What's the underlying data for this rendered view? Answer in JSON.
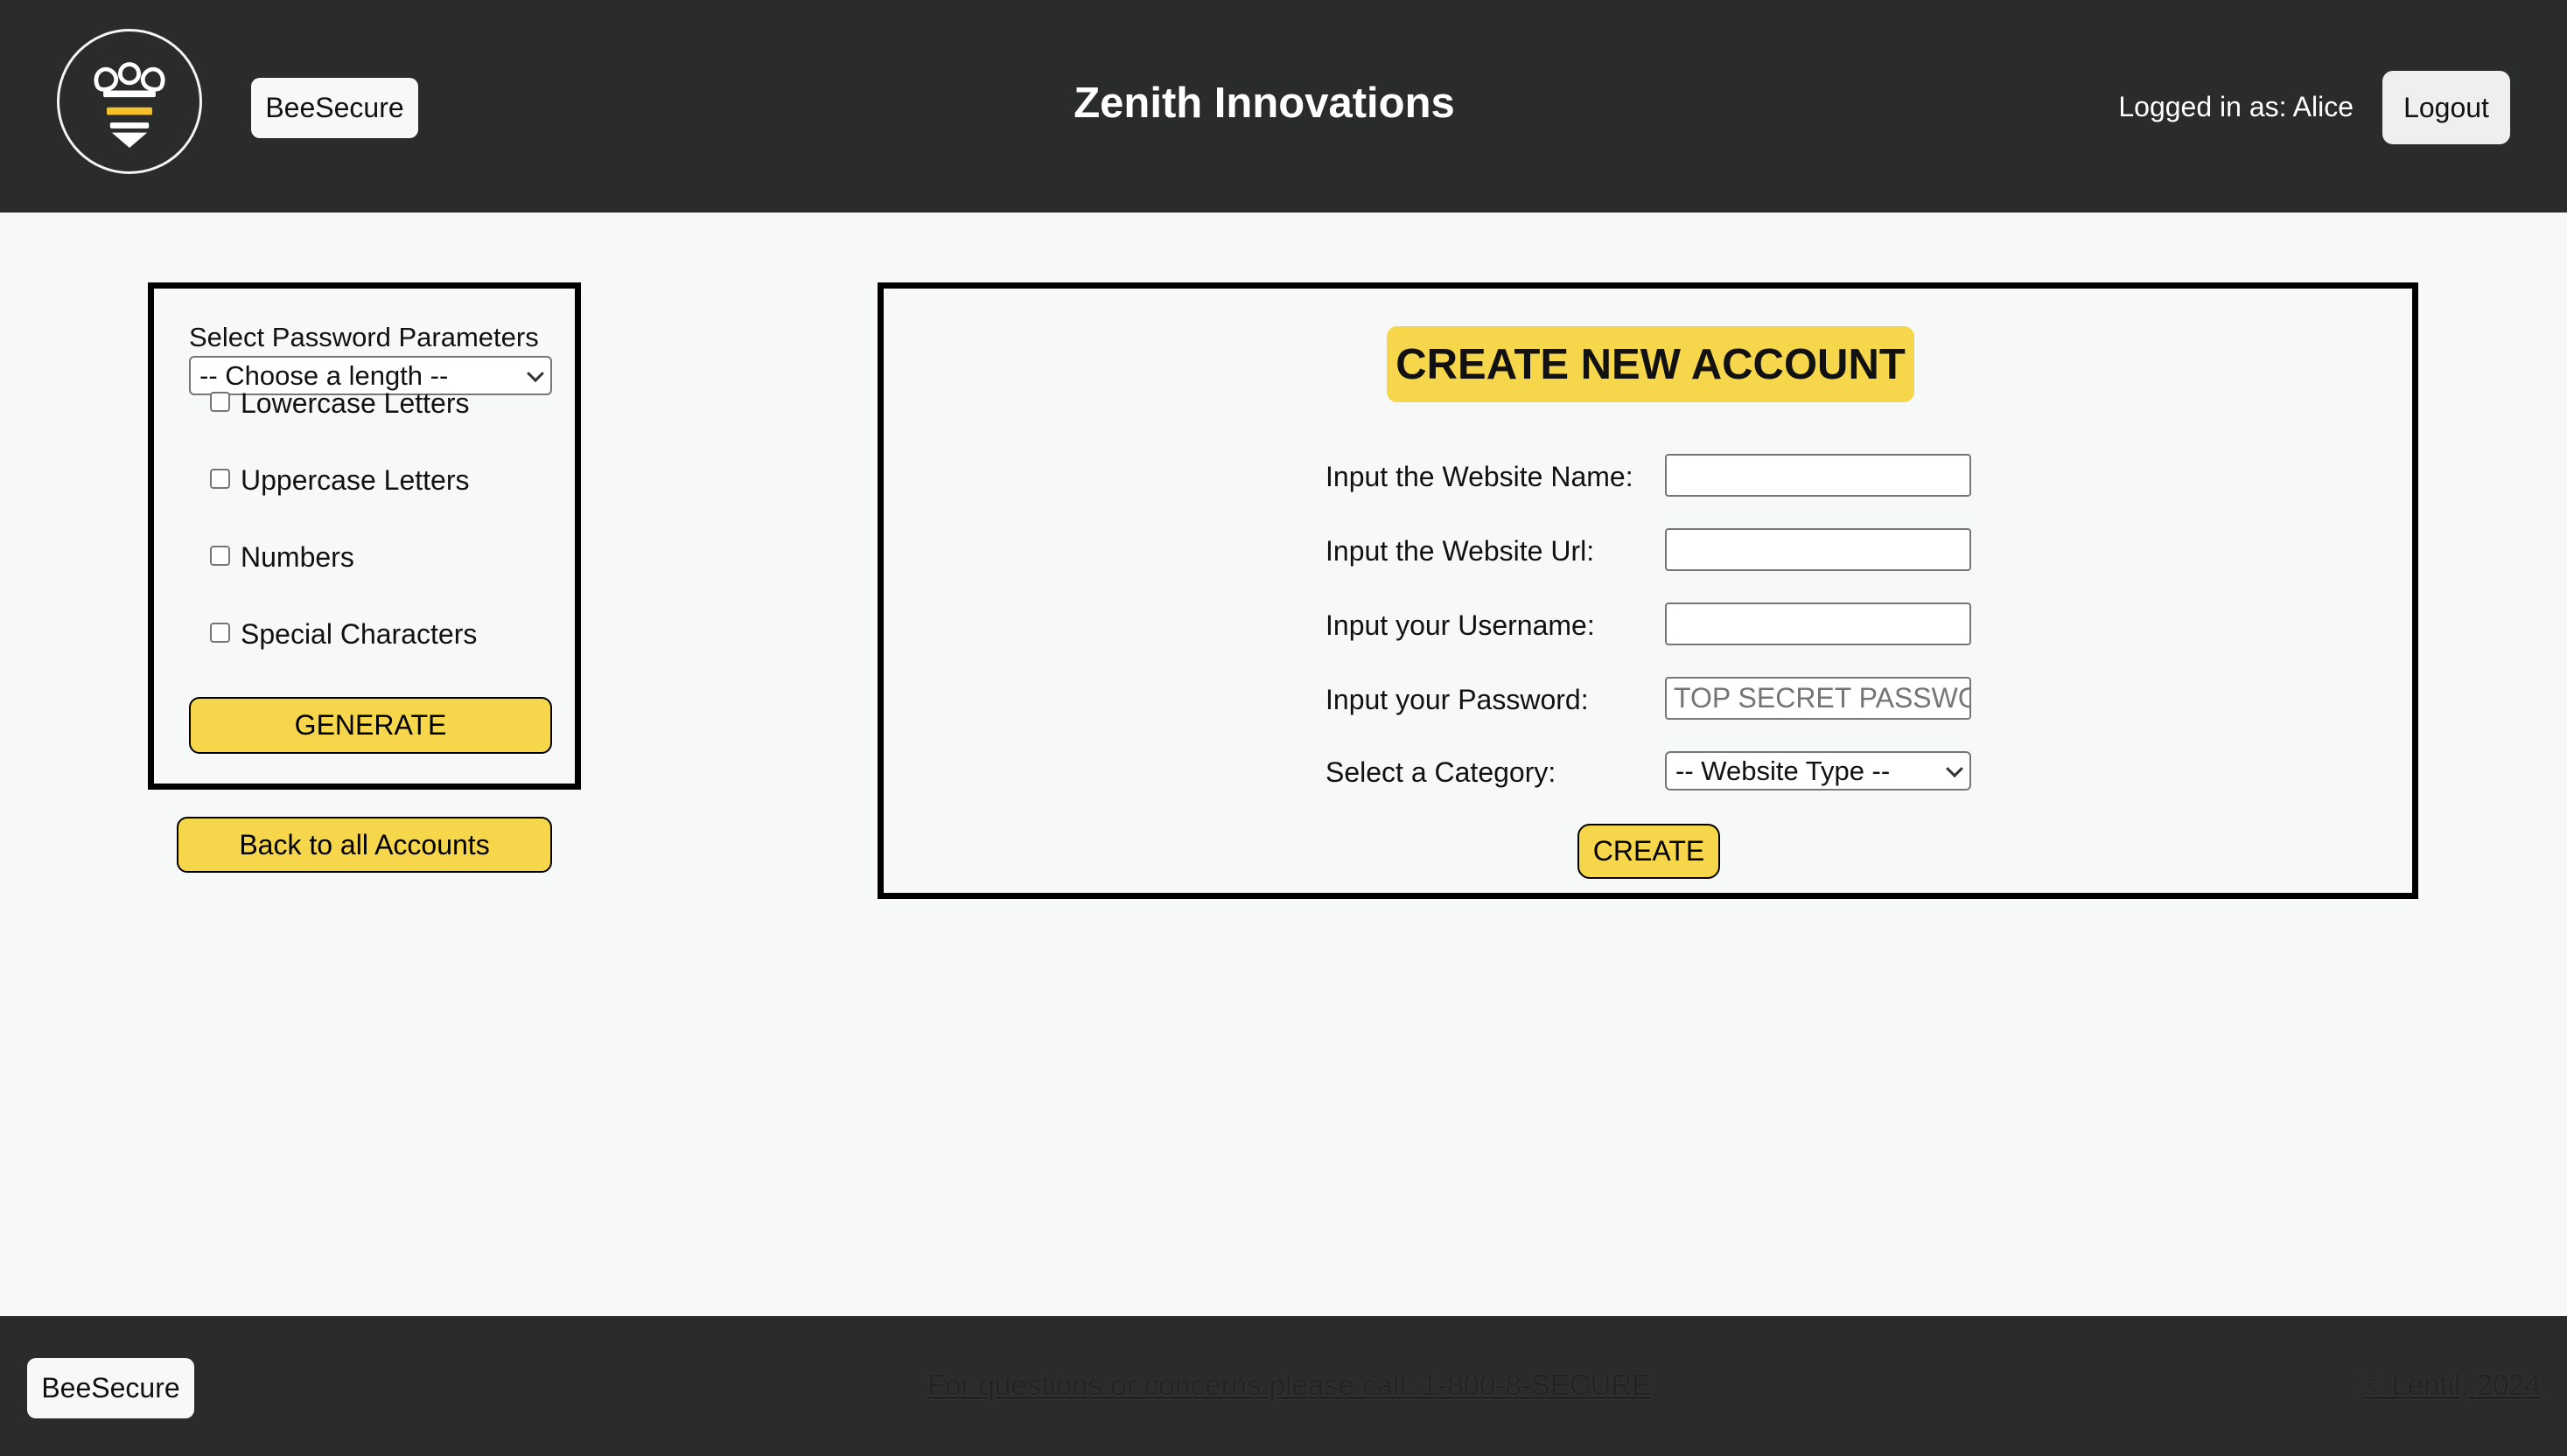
{
  "header": {
    "brand_label": "BeeSecure",
    "company_name": "Zenith Innovations",
    "logged_in_text": "Logged in as: Alice",
    "logout_label": "Logout",
    "logo_icon": "bee-logo-icon"
  },
  "password_params": {
    "title": "Select Password Parameters",
    "length_select_value": "-- Choose a length --",
    "options": [
      {
        "label": "Lowercase Letters",
        "checked": false
      },
      {
        "label": "Uppercase Letters",
        "checked": false
      },
      {
        "label": "Numbers",
        "checked": false
      },
      {
        "label": "Special Characters",
        "checked": false
      }
    ],
    "generate_label": "GENERATE"
  },
  "back_label": "Back to all Accounts",
  "create_account": {
    "title": "CREATE NEW ACCOUNT",
    "fields": [
      {
        "label": "Input the Website Name:",
        "value": "",
        "placeholder": ""
      },
      {
        "label": "Input the Website Url:",
        "value": "",
        "placeholder": ""
      },
      {
        "label": "Input your Username:",
        "value": "",
        "placeholder": ""
      },
      {
        "label": "Input your Password:",
        "value": "",
        "placeholder": "TOP SECRET PASSWORD"
      }
    ],
    "category_label": "Select a Category:",
    "category_select_value": "-- Website Type --",
    "create_label": "CREATE"
  },
  "footer": {
    "brand_label": "BeeSecure",
    "contact_text": "For questions or concerns please call: 1-800-8-SECURE",
    "copyright_text": "© Lentil, 2024"
  },
  "colors": {
    "header_bg": "#2a2c2c",
    "accent_yellow": "#f6d64b",
    "page_bg": "#f7f9f8"
  }
}
